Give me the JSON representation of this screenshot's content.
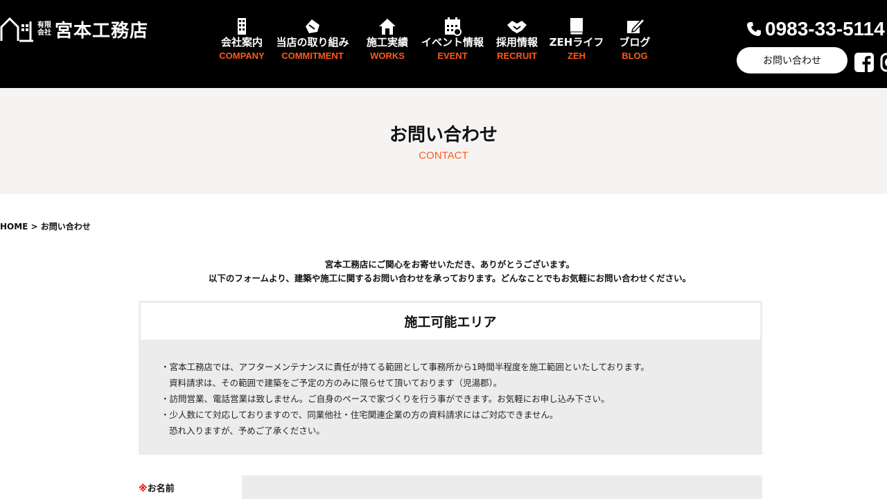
{
  "header": {
    "logo": {
      "sub_top": "有限",
      "sub_bottom": "会社",
      "name": "宮本工務店"
    },
    "nav": [
      {
        "ja": "会社案内",
        "en": "COMPANY",
        "icon": "building-icon"
      },
      {
        "ja": "当店の取り組み",
        "en": "COMMITMENT",
        "icon": "hand-icon"
      },
      {
        "ja": "施工実績",
        "en": "WORKS",
        "icon": "house-icon"
      },
      {
        "ja": "イベント情報",
        "en": "EVENT",
        "icon": "calendar-icon"
      },
      {
        "ja": "採用情報",
        "en": "RECRUIT",
        "icon": "handshake-icon"
      },
      {
        "ja": "ZEHライフ",
        "en": "ZEH",
        "icon": "book-icon"
      },
      {
        "ja": "ブログ",
        "en": "BLOG",
        "icon": "pen-icon"
      }
    ],
    "phone": "0983-33-5114",
    "contact_button": "お問い合わせ",
    "colors": {
      "accent": "#ff5a1a",
      "header_bg": "#000000"
    }
  },
  "page": {
    "title": "お問い合わせ",
    "subtitle": "CONTACT"
  },
  "breadcrumb": "HOME > お問い合わせ",
  "intro": [
    "宮本工務店にご関心をお寄せいただき、ありがとうございます。",
    "以下のフォームより、建築や施工に関するお問い合わせを承っております。どんなことでもお気軽にお問い合わせください。"
  ],
  "area": {
    "heading": "施工可能エリア",
    "lines": [
      "・宮本工務店では、アフターメンテナンスに責任が持てる範囲として事務所から1時間半程度を施工範囲といたしております。",
      "資料請求は、その範囲で建築をご予定の方のみに限らせて頂いております（児湯郡）。",
      "・訪問営業、電話営業は致しません。ご自身のペースで家づくりを行う事ができます。お気軽にお申し込み下さい。",
      "・少人数にて対応しておりますので、同業他社・住宅関連企業の方の資料請求にはご対応できません。",
      "恐れ入りますが、予めご了承ください。"
    ]
  },
  "form": {
    "name_required_mark": "※",
    "name_label": "お名前"
  }
}
